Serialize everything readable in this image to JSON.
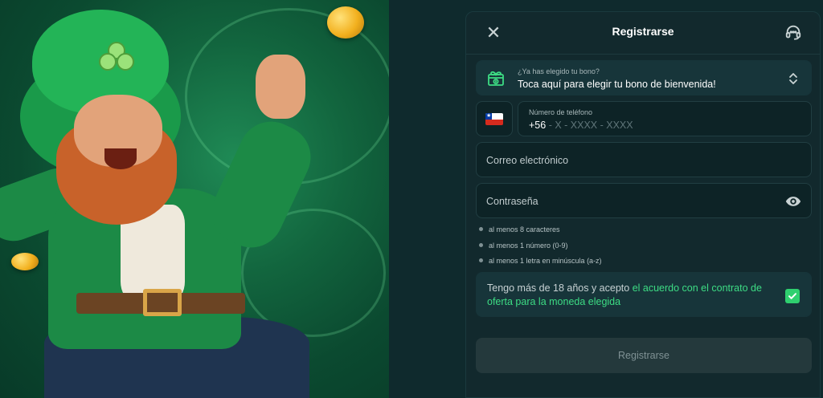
{
  "panel": {
    "title": "Registrarse",
    "close_icon": "close-icon",
    "support_icon": "headset-icon"
  },
  "bonus": {
    "question": "¿Ya has elegido tu bono?",
    "prompt": "Toca aquí para elegir tu bono de bienvenida!",
    "icon": "gift-icon"
  },
  "phone": {
    "country": "Chile",
    "flag_icon": "chile-flag-icon",
    "label": "Número de teléfono",
    "prefix": "+56",
    "placeholder": " - X - XXXX - XXXX"
  },
  "email": {
    "placeholder": "Correo electrónico"
  },
  "password": {
    "placeholder": "Contraseña",
    "toggle_icon": "eye-icon"
  },
  "password_rules": [
    "al menos 8 caracteres",
    "al menos 1 número (0-9)",
    "al menos 1 letra en minúscula (a-z)"
  ],
  "terms": {
    "prefix": "Tengo más de 18 años y acepto ",
    "link": "el acuerdo con el contrato de oferta para la moneda elegida",
    "checked": true
  },
  "submit": {
    "label": "Registrarse"
  },
  "colors": {
    "accent": "#3ddc84",
    "panel_bg": "#12292d",
    "page_bg": "#0f2a2d"
  }
}
